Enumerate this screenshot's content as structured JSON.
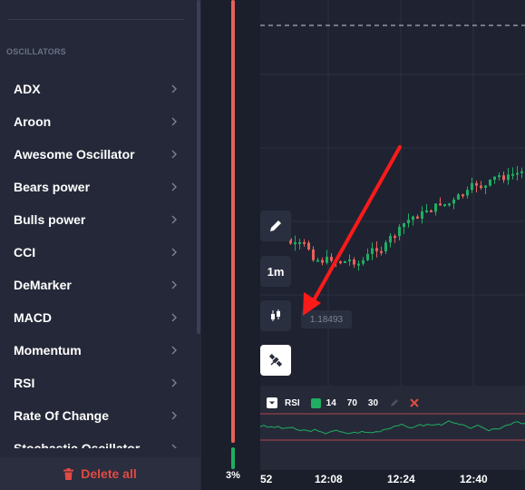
{
  "sidebar": {
    "section_title": "OSCILLATORS",
    "items": [
      {
        "label": "ADX"
      },
      {
        "label": "Aroon"
      },
      {
        "label": "Awesome Oscillator"
      },
      {
        "label": "Bears power"
      },
      {
        "label": "Bulls power"
      },
      {
        "label": "CCI"
      },
      {
        "label": "DeMarker"
      },
      {
        "label": "MACD"
      },
      {
        "label": "Momentum"
      },
      {
        "label": "RSI"
      },
      {
        "label": "Rate Of Change"
      },
      {
        "label": "Stochastic Oscillator"
      }
    ],
    "delete_label": "Delete all",
    "icons": {
      "chevron": "chevron-right-icon",
      "trash": "trash-icon"
    }
  },
  "strip": {
    "percent": "3%",
    "green_fraction": 0.03
  },
  "tools": {
    "timeframe": "1m",
    "icons": [
      "pencil-icon",
      "candles-icon",
      "satellite-icon"
    ]
  },
  "chart": {
    "price_label": "1.18493",
    "time_labels": [
      "52",
      "12:08",
      "12:24",
      "12:40"
    ],
    "colors": {
      "up": "#1fae63",
      "down": "#e8615a",
      "annotation": "#ff1a1a"
    }
  },
  "rsi": {
    "label": "RSI",
    "period": "14",
    "upper": "70",
    "lower": "30",
    "color": "#1fae63"
  }
}
